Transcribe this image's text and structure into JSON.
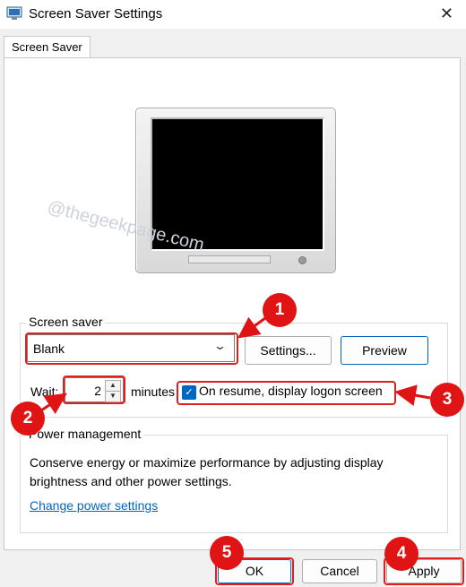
{
  "window": {
    "title": "Screen Saver Settings",
    "close_glyph": "✕"
  },
  "tabs": [
    {
      "label": "Screen Saver"
    }
  ],
  "watermark": "@thegeekpage.com",
  "screen_saver": {
    "group_label": "Screen saver",
    "selected": "Blank",
    "settings_label": "Settings...",
    "preview_label": "Preview",
    "wait_label": "Wait:",
    "wait_value": "2",
    "minutes_label": "minutes",
    "logon_checked": true,
    "logon_label": "On resume, display logon screen"
  },
  "power": {
    "group_label": "Power management",
    "description": "Conserve energy or maximize performance by adjusting display brightness and other power settings.",
    "link": "Change power settings"
  },
  "footer": {
    "ok": "OK",
    "cancel": "Cancel",
    "apply": "Apply"
  },
  "annotations": {
    "markers": [
      "1",
      "2",
      "3",
      "4",
      "5"
    ],
    "color": "#e01414"
  },
  "colors": {
    "accent": "#0067c0"
  }
}
